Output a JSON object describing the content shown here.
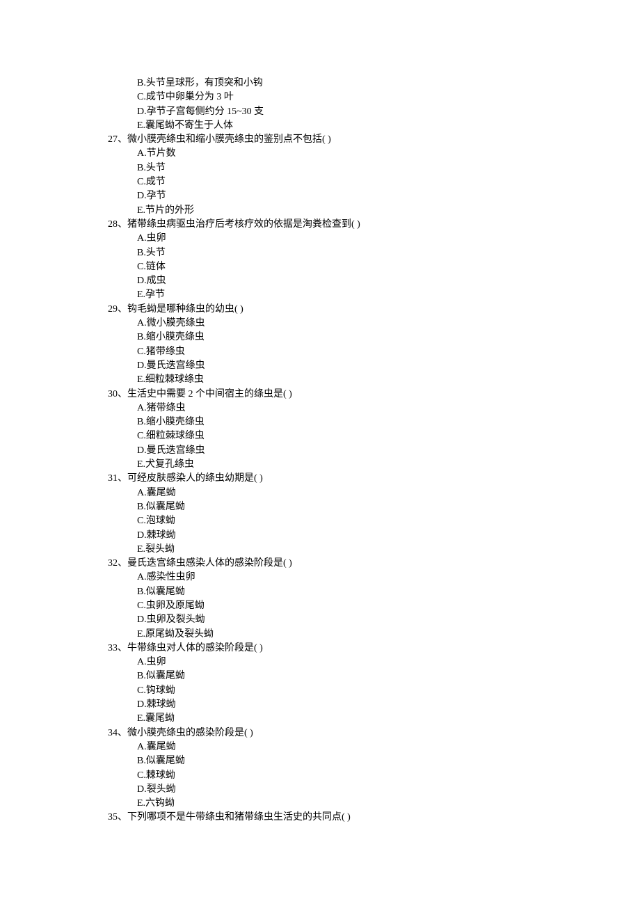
{
  "lines": [
    {
      "indent": "option",
      "text": "B.头节呈球形，有顶突和小钩"
    },
    {
      "indent": "option",
      "text": "C.成节中卵巢分为 3 叶"
    },
    {
      "indent": "option",
      "text": "D.孕节子宫每侧约分 15~30 支"
    },
    {
      "indent": "option",
      "text": "E.囊尾蚴不寄生于人体"
    },
    {
      "indent": "question",
      "text": "27、微小膜壳绦虫和缩小膜壳绦虫的鉴别点不包括( )"
    },
    {
      "indent": "option",
      "text": "A.节片数"
    },
    {
      "indent": "option",
      "text": "B.头节"
    },
    {
      "indent": "option",
      "text": "C.成节"
    },
    {
      "indent": "option",
      "text": "D.孕节"
    },
    {
      "indent": "option",
      "text": "E.节片的外形"
    },
    {
      "indent": "question",
      "text": "28、猪带绦虫病驱虫治疗后考核疗效的依据是淘粪检查到( )"
    },
    {
      "indent": "option",
      "text": "A.虫卵"
    },
    {
      "indent": "option",
      "text": "B.头节"
    },
    {
      "indent": "option",
      "text": "C.链体"
    },
    {
      "indent": "option",
      "text": "D.成虫"
    },
    {
      "indent": "option",
      "text": "E.孕节"
    },
    {
      "indent": "question",
      "text": "29、钩毛蚴是哪种绦虫的幼虫( )"
    },
    {
      "indent": "option",
      "text": "A.微小膜壳绦虫"
    },
    {
      "indent": "option",
      "text": "B.缩小膜壳绦虫"
    },
    {
      "indent": "option",
      "text": "C.猪带绦虫"
    },
    {
      "indent": "option",
      "text": "D.曼氏迭宫绦虫"
    },
    {
      "indent": "option",
      "text": "E.细粒棘球绦虫"
    },
    {
      "indent": "question",
      "text": "30、生活史中需要 2 个中间宿主的绦虫是( )"
    },
    {
      "indent": "option",
      "text": "A.猪带绦虫"
    },
    {
      "indent": "option",
      "text": "B.缩小膜壳绦虫"
    },
    {
      "indent": "option",
      "text": "C.细粒棘球绦虫"
    },
    {
      "indent": "option",
      "text": "D.曼氏迭宫绦虫"
    },
    {
      "indent": "option",
      "text": "E.犬复孔绦虫"
    },
    {
      "indent": "question",
      "text": "31、可经皮肤感染人的绦虫幼期是( )"
    },
    {
      "indent": "option",
      "text": "A.囊尾蚴"
    },
    {
      "indent": "option",
      "text": "B.似囊尾蚴"
    },
    {
      "indent": "option",
      "text": "C.泡球蚴"
    },
    {
      "indent": "option",
      "text": "D.棘球蚴"
    },
    {
      "indent": "option",
      "text": "E.裂头蚴"
    },
    {
      "indent": "question",
      "text": "32、曼氏迭宫绦虫感染人体的感染阶段是( )"
    },
    {
      "indent": "option",
      "text": "A.感染性虫卵"
    },
    {
      "indent": "option",
      "text": "B.似囊尾蚴"
    },
    {
      "indent": "option",
      "text": "C.虫卵及原尾蚴"
    },
    {
      "indent": "option",
      "text": "D.虫卵及裂头蚴"
    },
    {
      "indent": "option",
      "text": "E.原尾蚴及裂头蚴"
    },
    {
      "indent": "question",
      "text": "33、牛带绦虫对人体的感染阶段是( )"
    },
    {
      "indent": "option",
      "text": "A.虫卵"
    },
    {
      "indent": "option",
      "text": "B.似囊尾蚴"
    },
    {
      "indent": "option",
      "text": "C.钩球蚴"
    },
    {
      "indent": "option",
      "text": "D.棘球蚴"
    },
    {
      "indent": "option",
      "text": "E.囊尾蚴"
    },
    {
      "indent": "question",
      "text": "34、微小膜壳绦虫的感染阶段是( )"
    },
    {
      "indent": "option",
      "text": "A.囊尾蚴"
    },
    {
      "indent": "option",
      "text": "B.似囊尾蚴"
    },
    {
      "indent": "option",
      "text": "C.棘球蚴"
    },
    {
      "indent": "option",
      "text": "D.裂头蚴"
    },
    {
      "indent": "option",
      "text": "E.六钩蚴"
    },
    {
      "indent": "question",
      "text": "35、下列哪项不是牛带绦虫和猪带绦虫生活史的共同点( )"
    }
  ]
}
